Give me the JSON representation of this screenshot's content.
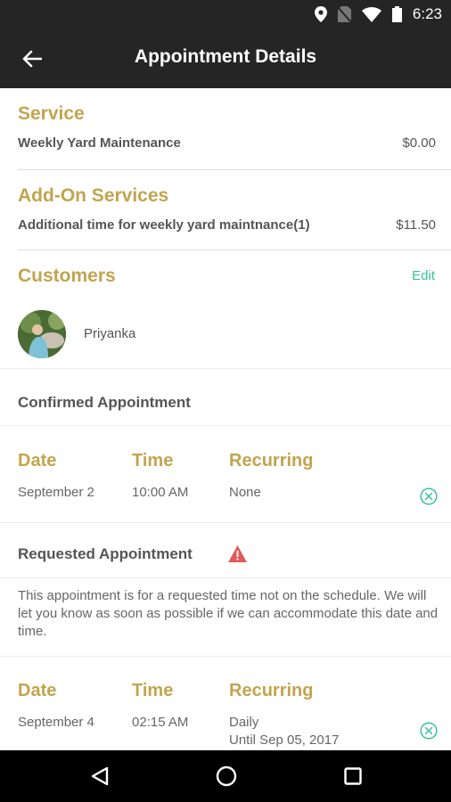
{
  "status_bar": {
    "time": "6:23",
    "icons": [
      "location-icon",
      "no-sim-icon",
      "wifi-icon",
      "battery-icon"
    ]
  },
  "toolbar": {
    "title": "Appointment Details",
    "back_icon": "arrow-left-icon"
  },
  "service": {
    "heading": "Service",
    "name": "Weekly Yard Maintenance",
    "price": "$0.00"
  },
  "addons": {
    "heading": "Add-On Services",
    "name": "Additional time for weekly yard maintnance(1)",
    "price": "$11.50"
  },
  "customers": {
    "heading": "Customers",
    "edit_label": "Edit",
    "list": [
      {
        "name": "Priyanka"
      }
    ]
  },
  "confirmed": {
    "heading": "Confirmed Appointment",
    "col_date": "Date",
    "col_time": "Time",
    "col_recurring": "Recurring",
    "date": "September 2",
    "time": "10:00 AM",
    "recurring": "None"
  },
  "requested": {
    "heading": "Requested Appointment",
    "notice": "This appointment is for a requested time not on the schedule. We will let you know as soon as possible if we can accommodate this date and time.",
    "col_date": "Date",
    "col_time": "Time",
    "col_recurring": "Recurring",
    "date": "September 4",
    "time": "02:15 AM",
    "recurring": "Daily",
    "until": "Until Sep 05, 2017"
  },
  "colors": {
    "accent_gold": "#c3a44e",
    "accent_teal": "#3bbf9e",
    "warning_red": "#e05a5a",
    "bar_dark": "#252525"
  },
  "nav_bar": {
    "icons": [
      "back-triangle-icon",
      "home-circle-icon",
      "recents-square-icon"
    ]
  }
}
